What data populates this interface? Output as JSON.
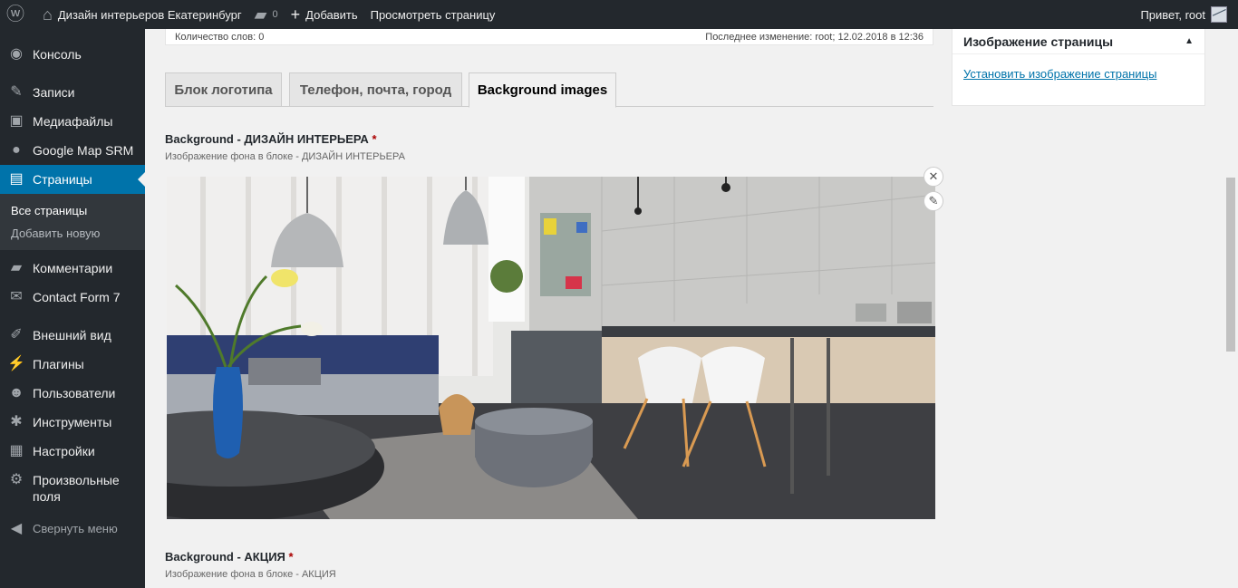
{
  "adminbar": {
    "wp_logo": "wordpress-icon",
    "site_name": "Дизайн интерьеров Екатеринбург",
    "comments_count": "0",
    "add_label": "Добавить",
    "view_label": "Просмотреть страницу",
    "greeting": "Привет, root"
  },
  "sidebar": {
    "items": [
      {
        "label": "Консоль",
        "icon": "dashboard-icon"
      },
      {
        "label": "Записи",
        "icon": "pin-icon"
      },
      {
        "label": "Медиафайлы",
        "icon": "media-icon"
      },
      {
        "label": "Google Map SRM",
        "icon": "map-pin-icon"
      },
      {
        "label": "Страницы",
        "icon": "pages-icon"
      },
      {
        "label": "Комментарии",
        "icon": "comment-icon"
      },
      {
        "label": "Contact Form 7",
        "icon": "mail-icon"
      },
      {
        "label": "Внешний вид",
        "icon": "brush-icon"
      },
      {
        "label": "Плагины",
        "icon": "plugin-icon"
      },
      {
        "label": "Пользователи",
        "icon": "user-icon"
      },
      {
        "label": "Инструменты",
        "icon": "wrench-icon"
      },
      {
        "label": "Настройки",
        "icon": "settings-icon"
      },
      {
        "label": "Произвольные поля",
        "icon": "gear-icon"
      },
      {
        "label": "Свернуть меню",
        "icon": "collapse-icon"
      }
    ],
    "submenu": [
      "Все страницы",
      "Добавить новую"
    ]
  },
  "editor": {
    "word_count": "Количество слов: 0",
    "last_edit": "Последнее изменение: root; 12.02.2018 в 12:36"
  },
  "tabs": [
    "Блок логотипа",
    "Телефон, почта, город",
    "Background images"
  ],
  "fields": [
    {
      "label": "Background - ДИЗАЙН ИНТЕРЬЕРА",
      "required": "*",
      "desc": "Изображение фона в блоке - ДИЗАЙН ИНТЕРЬЕРА"
    },
    {
      "label": "Background - АКЦИЯ",
      "required": "*",
      "desc": "Изображение фона в блоке - АКЦИЯ"
    }
  ],
  "featured_box": {
    "title": "Изображение страницы",
    "link": "Установить изображение страницы"
  },
  "colors": {
    "accent": "#0073aa",
    "adminbar": "#23282d"
  }
}
